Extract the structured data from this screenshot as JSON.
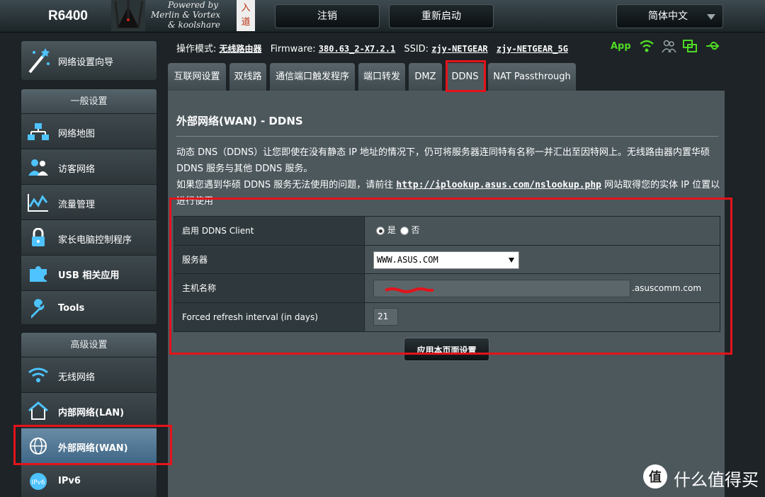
{
  "header": {
    "model": "R6400",
    "brand_line1": "Powered by",
    "brand_line2": "Merlin & Vortex",
    "brand_line3": "& koolshare",
    "logout": "注销",
    "reboot": "重新启动",
    "language": "简体中文"
  },
  "sidebar": {
    "wizard": "网络设置向导",
    "general_title": "一般设置",
    "general_items": [
      "网络地图",
      "访客网络",
      "流量管理",
      "家长电脑控制程序",
      "USB 相关应用",
      "Tools"
    ],
    "advanced_title": "高级设置",
    "advanced_items": [
      "无线网络",
      "内部网络(LAN)",
      "外部网络(WAN)",
      "IPv6"
    ]
  },
  "status": {
    "mode_label": "操作模式:",
    "mode_value": "无线路由器",
    "firmware_label": "Firmware:",
    "firmware_value": "380.63_2-X7.2.1",
    "ssid_label": "SSID:",
    "ssid_1": "zjy-NETGEAR",
    "ssid_2": "zjy-NETGEAR_5G",
    "app": "App"
  },
  "tabs": [
    "互联网设置",
    "双线路",
    "通信端口触发程序",
    "端口转发",
    "DMZ",
    "DDNS",
    "NAT Passthrough"
  ],
  "page": {
    "title": "外部网络(WAN) - DDNS",
    "desc_line1": "动态 DNS（DDNS）让您即使在没有静态 IP 地址的情况下，仍可将服务器连同特有名称一并汇出至因特网上。无线路由器内置华硕 DDNS 服务与其他 DDNS 服务。",
    "desc_line2_pre": "如果您遇到华硕 DDNS 服务无法使用的问题，请前往",
    "desc_link": "http://iplookup.asus.com/nslookup.php",
    "desc_line2_post": "网站取得您的实体 IP 位置以进行使用"
  },
  "form": {
    "enable_label": "启用 DDNS Client",
    "yes": "是",
    "no": "否",
    "server_label": "服务器",
    "server_value": "WWW.ASUS.COM",
    "hostname_label": "主机名称",
    "hostname_suffix": ".asuscomm.com",
    "refresh_label": "Forced refresh interval (in days)",
    "refresh_value": "21",
    "apply": "应用本页面设置"
  },
  "watermark": "什么值得买",
  "colors": {
    "accent_red": "#e4131b",
    "app_green": "#4fda24",
    "active_nav": "#4f7898"
  }
}
